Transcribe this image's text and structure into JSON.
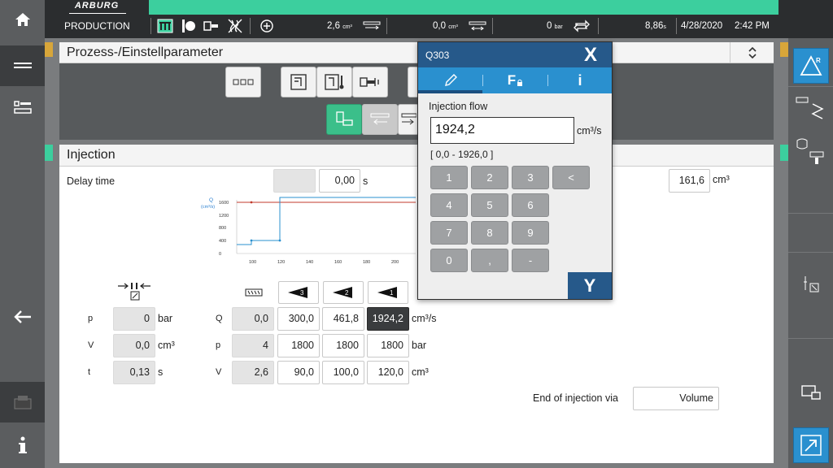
{
  "header": {
    "logo": "ARBURG",
    "mode": "PRODUCTION",
    "volume_value": "2,6",
    "volume_unit": "cm³",
    "volume2_value": "0,0",
    "volume2_unit": "cm³",
    "pressure_value": "0",
    "pressure_unit": "bar",
    "cycle_value": "8,86",
    "cycle_unit": "s",
    "date": "4/28/2020",
    "time": "2:42 PM"
  },
  "upper_panel": {
    "title": "Prozess-/Einstellparameter"
  },
  "injection": {
    "title": "Injection",
    "delay_label": "Delay time",
    "delay_value": "0,00",
    "delay_unit": "s",
    "volume_value": "161,6",
    "volume_unit": "cm³",
    "left_table": {
      "rows": [
        {
          "label": "p",
          "value": "0",
          "unit": "bar"
        },
        {
          "label": "V",
          "value": "0,0",
          "unit": "cm³"
        },
        {
          "label": "t",
          "value": "0,13",
          "unit": "s"
        }
      ]
    },
    "ramp_labels": [
      "3",
      "2",
      "1"
    ],
    "right_table": {
      "rows": [
        {
          "label": "Q",
          "actual": "0,0",
          "v3": "300,0",
          "v2": "461,8",
          "v1": "1924,2",
          "unit": "cm³/s"
        },
        {
          "label": "p",
          "actual": "4",
          "v3": "1800",
          "v2": "1800",
          "v1": "1800",
          "unit": "bar"
        },
        {
          "label": "V",
          "actual": "2,6",
          "v3": "90,0",
          "v2": "100,0",
          "v1": "120,0",
          "unit": "cm³"
        }
      ]
    },
    "end_label": "End of injection via",
    "end_value": "Volume"
  },
  "mini_chart": {
    "y_axis_title": "Q",
    "y_axis_unit": "(cm³/s)",
    "y_ticks": [
      "1600",
      "1200",
      "800",
      "400",
      "0"
    ],
    "x_ticks": [
      "100",
      "120",
      "140",
      "160",
      "180",
      "200"
    ]
  },
  "dialog": {
    "title": "Q303",
    "close_label": "X",
    "tab_info": "i",
    "tab_f": "F",
    "field_label": "Injection flow",
    "value": "1924,2",
    "unit": "cm³/s",
    "range": "[ 0,0 - 1926,0 ]",
    "keys": [
      "1",
      "2",
      "3",
      "<",
      "4",
      "5",
      "6",
      "7",
      "8",
      "9",
      "0",
      ",",
      "-"
    ],
    "ok_label": "Y"
  },
  "colors": {
    "status_green": "#3ccf9e",
    "dialog_blue": "#26598a",
    "tab_blue": "#2a90cf",
    "accent_orange": "#d8a63a"
  }
}
